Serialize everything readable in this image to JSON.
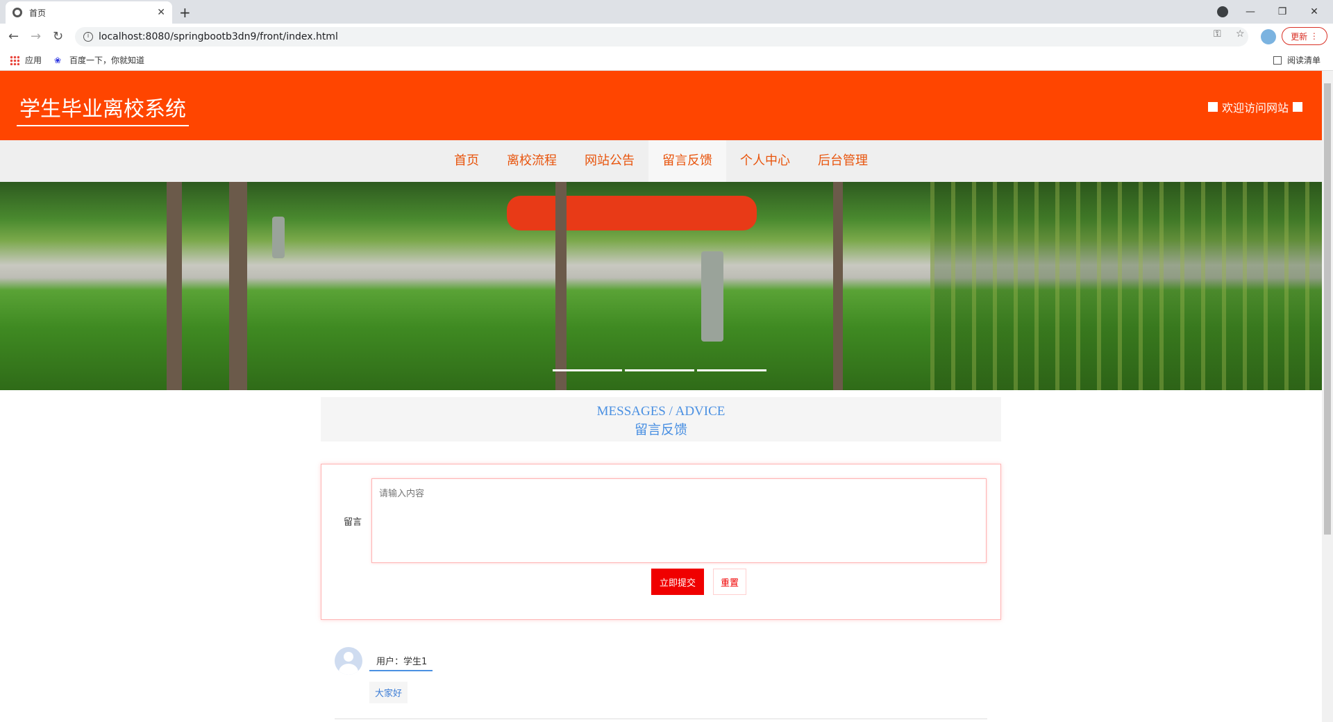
{
  "browser": {
    "tab_title": "首页",
    "tab_close": "✕",
    "new_tab": "+",
    "url": "localhost:8080/springbootb3dn9/front/index.html",
    "update_label": "更新",
    "bookmarks": [
      {
        "label": "应用",
        "icon": "apps-icon"
      },
      {
        "label": "百度一下，你就知道",
        "icon": "baidu-icon"
      }
    ],
    "reading_list": "阅读清单",
    "window_controls": {
      "minimize": "—",
      "restore": "❐",
      "close": "✕"
    }
  },
  "header": {
    "site_title": "学生毕业离校系统",
    "welcome": "欢迎访问网站",
    "color": "#ff4500"
  },
  "nav": {
    "items": [
      {
        "label": "首页",
        "active": false
      },
      {
        "label": "离校流程",
        "active": false
      },
      {
        "label": "网站公告",
        "active": false
      },
      {
        "label": "留言反馈",
        "active": true
      },
      {
        "label": "个人中心",
        "active": false
      },
      {
        "label": "后台管理",
        "active": false
      }
    ],
    "text_color": "#e8540c"
  },
  "banner": {
    "indicators": 3
  },
  "section": {
    "title_en": "MESSAGES / ADVICE",
    "title_zh": "留言反馈"
  },
  "form": {
    "label": "留言",
    "placeholder": "请输入内容",
    "submit_label": "立即提交",
    "reset_label": "重置",
    "accent": "#f00000"
  },
  "messages": [
    {
      "user": "用户：学生1",
      "content": "大家好"
    }
  ]
}
